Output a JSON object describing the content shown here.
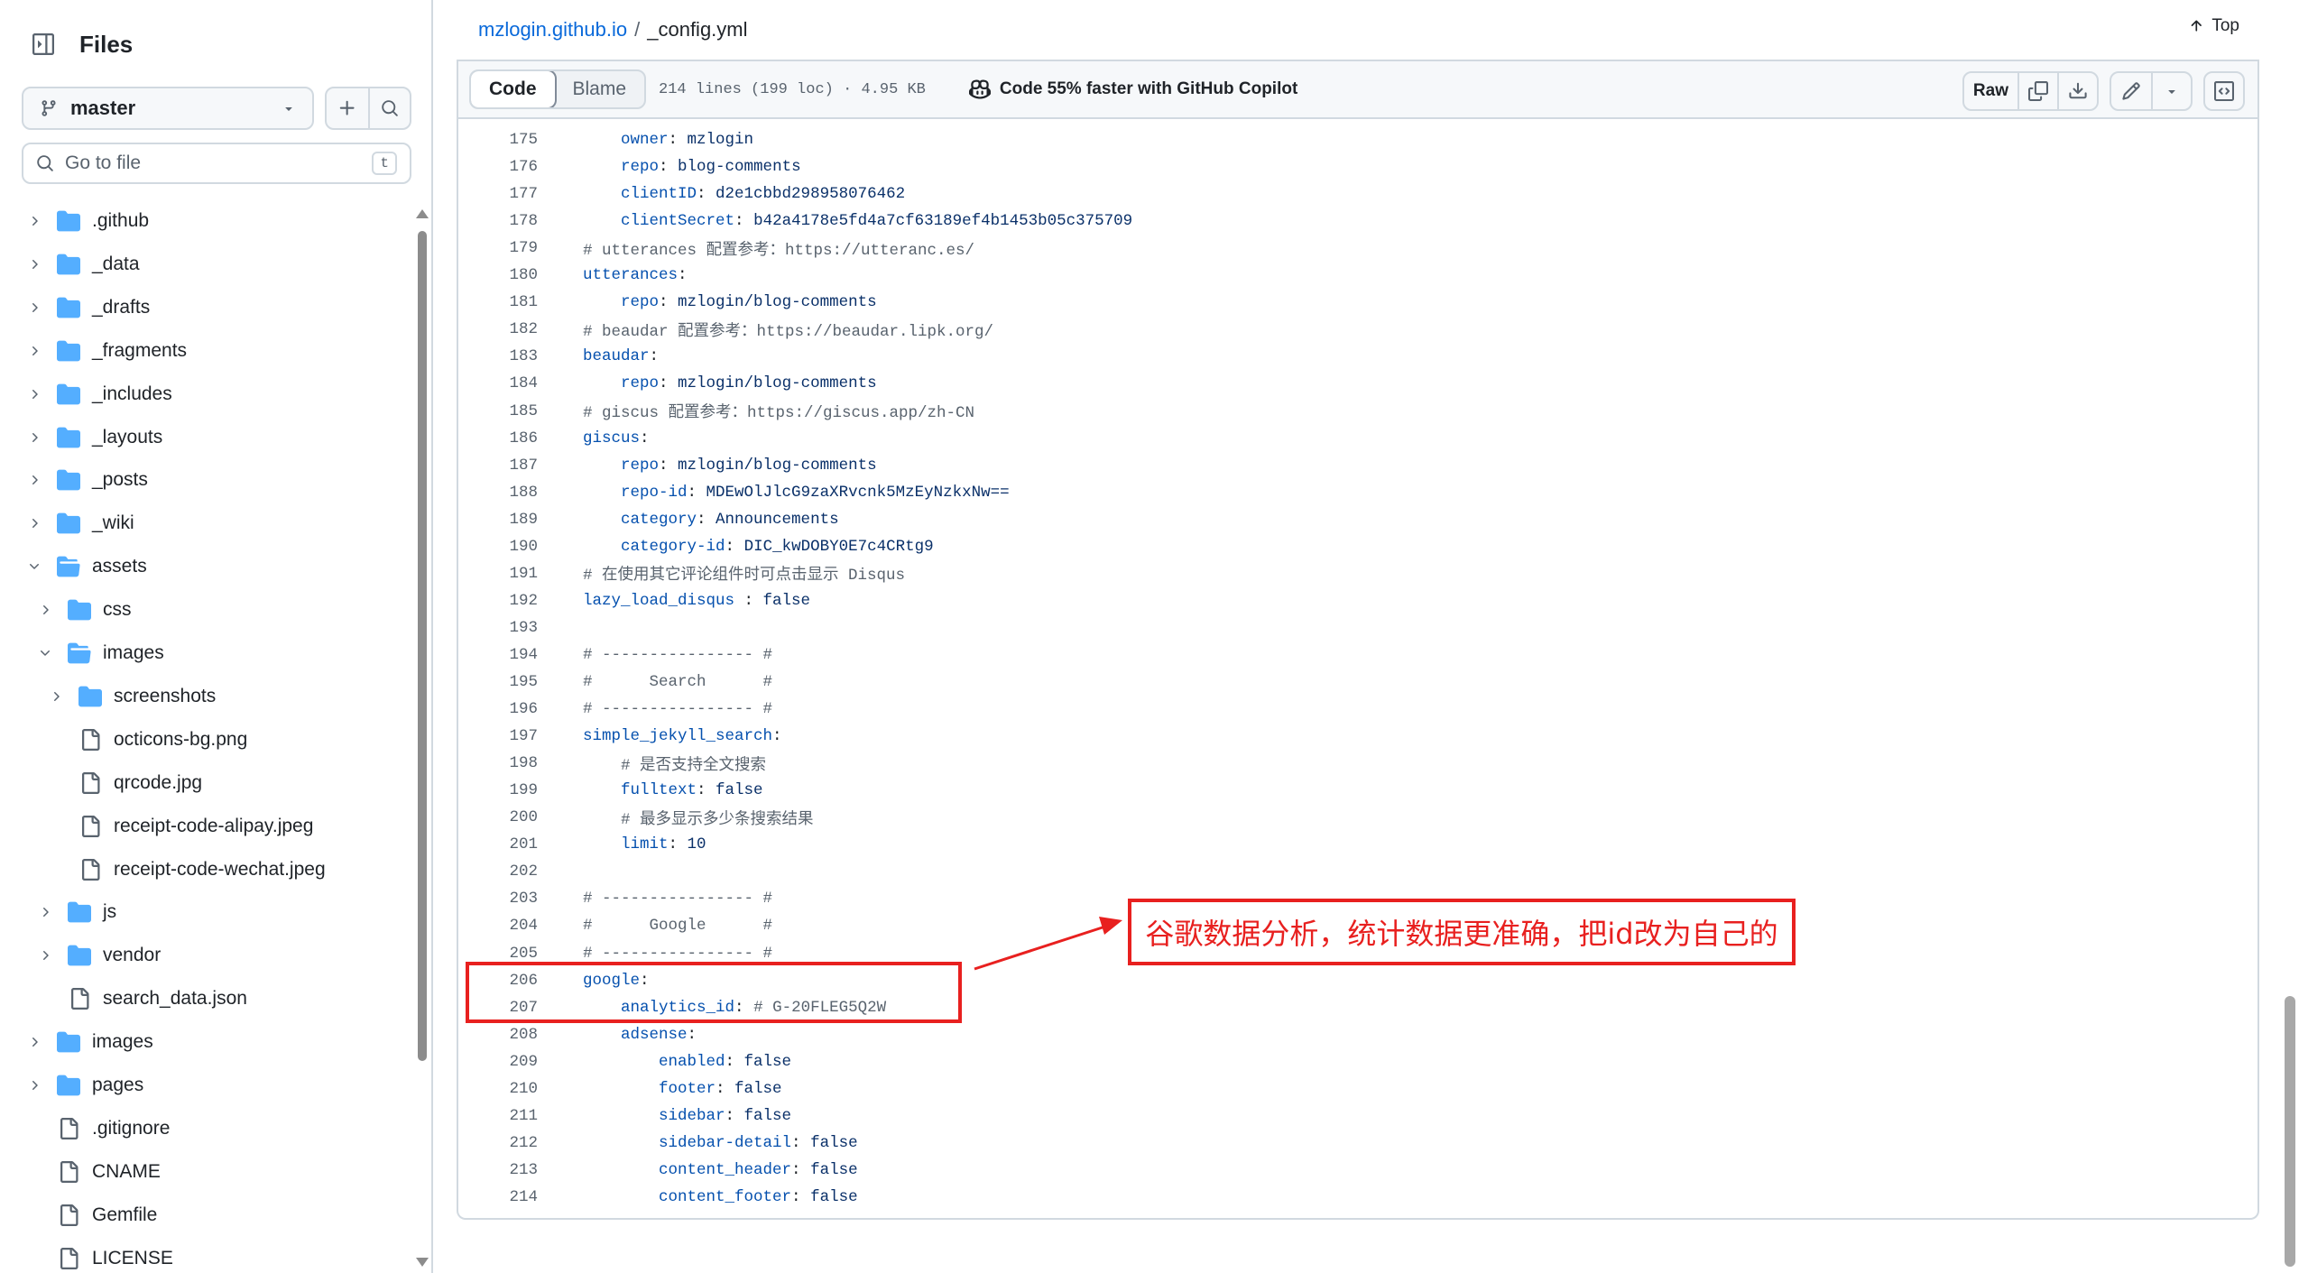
{
  "sidebar": {
    "title": "Files",
    "branch": "master",
    "goto_placeholder": "Go to file",
    "goto_shortcut": "t",
    "tree": [
      {
        "label": ".github",
        "type": "folder",
        "depth": 0,
        "expanded": false
      },
      {
        "label": "_data",
        "type": "folder",
        "depth": 0,
        "expanded": false
      },
      {
        "label": "_drafts",
        "type": "folder",
        "depth": 0,
        "expanded": false
      },
      {
        "label": "_fragments",
        "type": "folder",
        "depth": 0,
        "expanded": false
      },
      {
        "label": "_includes",
        "type": "folder",
        "depth": 0,
        "expanded": false
      },
      {
        "label": "_layouts",
        "type": "folder",
        "depth": 0,
        "expanded": false
      },
      {
        "label": "_posts",
        "type": "folder",
        "depth": 0,
        "expanded": false
      },
      {
        "label": "_wiki",
        "type": "folder",
        "depth": 0,
        "expanded": false
      },
      {
        "label": "assets",
        "type": "folder-open",
        "depth": 0,
        "expanded": true
      },
      {
        "label": "css",
        "type": "folder",
        "depth": 1,
        "expanded": false
      },
      {
        "label": "images",
        "type": "folder-open",
        "depth": 1,
        "expanded": true
      },
      {
        "label": "screenshots",
        "type": "folder",
        "depth": 2,
        "expanded": false
      },
      {
        "label": "octicons-bg.png",
        "type": "file",
        "depth": 2
      },
      {
        "label": "qrcode.jpg",
        "type": "file",
        "depth": 2
      },
      {
        "label": "receipt-code-alipay.jpeg",
        "type": "file",
        "depth": 2
      },
      {
        "label": "receipt-code-wechat.jpeg",
        "type": "file",
        "depth": 2
      },
      {
        "label": "js",
        "type": "folder",
        "depth": 1,
        "expanded": false
      },
      {
        "label": "vendor",
        "type": "folder",
        "depth": 1,
        "expanded": false
      },
      {
        "label": "search_data.json",
        "type": "file",
        "depth": 1
      },
      {
        "label": "images",
        "type": "folder",
        "depth": 0,
        "expanded": false
      },
      {
        "label": "pages",
        "type": "folder",
        "depth": 0,
        "expanded": false
      },
      {
        "label": ".gitignore",
        "type": "file",
        "depth": 0
      },
      {
        "label": "CNAME",
        "type": "file",
        "depth": 0
      },
      {
        "label": "Gemfile",
        "type": "file",
        "depth": 0
      },
      {
        "label": "LICENSE",
        "type": "file",
        "depth": 0
      }
    ]
  },
  "breadcrumb": {
    "repo": "mzlogin.github.io",
    "separator": "/",
    "file": "_config.yml"
  },
  "top_link": "Top",
  "toolbar": {
    "code_tab": "Code",
    "blame_tab": "Blame",
    "meta": "214 lines (199 loc) · 4.95 KB",
    "copilot": "Code 55% faster with GitHub Copilot",
    "raw": "Raw"
  },
  "code_lines": [
    {
      "n": "175",
      "indent": 4,
      "key": "owner",
      "value": "mzlogin"
    },
    {
      "n": "176",
      "indent": 4,
      "key": "repo",
      "value": "blog-comments"
    },
    {
      "n": "177",
      "indent": 4,
      "key": "clientID",
      "value": "d2e1cbbd298958076462"
    },
    {
      "n": "178",
      "indent": 4,
      "key": "clientSecret",
      "value": "b42a4178e5fd4a7cf63189ef4b1453b05c375709"
    },
    {
      "n": "179",
      "indent": 0,
      "comment": "# utterances 配置参考：https://utteranc.es/"
    },
    {
      "n": "180",
      "indent": 0,
      "key": "utterances",
      "value": ""
    },
    {
      "n": "181",
      "indent": 4,
      "key": "repo",
      "value": "mzlogin/blog-comments"
    },
    {
      "n": "182",
      "indent": 0,
      "comment": "# beaudar 配置参考：https://beaudar.lipk.org/"
    },
    {
      "n": "183",
      "indent": 0,
      "key": "beaudar",
      "value": ""
    },
    {
      "n": "184",
      "indent": 4,
      "key": "repo",
      "value": "mzlogin/blog-comments"
    },
    {
      "n": "185",
      "indent": 0,
      "comment": "# giscus 配置参考：https://giscus.app/zh-CN"
    },
    {
      "n": "186",
      "indent": 0,
      "key": "giscus",
      "value": ""
    },
    {
      "n": "187",
      "indent": 4,
      "key": "repo",
      "value": "mzlogin/blog-comments"
    },
    {
      "n": "188",
      "indent": 4,
      "key": "repo-id",
      "value": "MDEwOlJlcG9zaXRvcnk5MzEyNzkxNw=="
    },
    {
      "n": "189",
      "indent": 4,
      "key": "category",
      "value": "Announcements"
    },
    {
      "n": "190",
      "indent": 4,
      "key": "category-id",
      "value": "DIC_kwDOBY0E7c4CRtg9"
    },
    {
      "n": "191",
      "indent": 0,
      "comment": "# 在使用其它评论组件时可点击显示 Disqus"
    },
    {
      "n": "192",
      "indent": 0,
      "key": "lazy_load_disqus ",
      "value": "false"
    },
    {
      "n": "193",
      "indent": 0,
      "text": ""
    },
    {
      "n": "194",
      "indent": 0,
      "comment": "# ---------------- #"
    },
    {
      "n": "195",
      "indent": 0,
      "comment": "#      Search      #"
    },
    {
      "n": "196",
      "indent": 0,
      "comment": "# ---------------- #"
    },
    {
      "n": "197",
      "indent": 0,
      "key": "simple_jekyll_search",
      "value": ""
    },
    {
      "n": "198",
      "indent": 4,
      "comment": "# 是否支持全文搜索"
    },
    {
      "n": "199",
      "indent": 4,
      "key": "fulltext",
      "value": "false"
    },
    {
      "n": "200",
      "indent": 4,
      "comment": "# 最多显示多少条搜索结果"
    },
    {
      "n": "201",
      "indent": 4,
      "key": "limit",
      "value": "10"
    },
    {
      "n": "202",
      "indent": 0,
      "text": ""
    },
    {
      "n": "203",
      "indent": 0,
      "comment": "# ---------------- #"
    },
    {
      "n": "204",
      "indent": 0,
      "comment": "#      Google      #"
    },
    {
      "n": "205",
      "indent": 0,
      "comment": "# ---------------- #"
    },
    {
      "n": "206",
      "indent": 0,
      "key": "google",
      "value": ""
    },
    {
      "n": "207",
      "indent": 4,
      "key": "analytics_id",
      "value": "",
      "trail_comment": "# G-20FLEG5Q2W"
    },
    {
      "n": "208",
      "indent": 4,
      "key": "adsense",
      "value": ""
    },
    {
      "n": "209",
      "indent": 8,
      "key": "enabled",
      "value": "false"
    },
    {
      "n": "210",
      "indent": 8,
      "key": "footer",
      "value": "false"
    },
    {
      "n": "211",
      "indent": 8,
      "key": "sidebar",
      "value": "false"
    },
    {
      "n": "212",
      "indent": 8,
      "key": "sidebar-detail",
      "value": "false"
    },
    {
      "n": "213",
      "indent": 8,
      "key": "content_header",
      "value": "false"
    },
    {
      "n": "214",
      "indent": 8,
      "key": "content_footer",
      "value": "false"
    }
  ],
  "annotation": {
    "text": "谷歌数据分析，统计数据更准确，把id改为自己的",
    "color": "#e8201f"
  },
  "colors": {
    "link": "#0969da",
    "folder": "#54aeff",
    "key": "#0550ae",
    "value": "#0a3069",
    "comment": "#59636e"
  }
}
